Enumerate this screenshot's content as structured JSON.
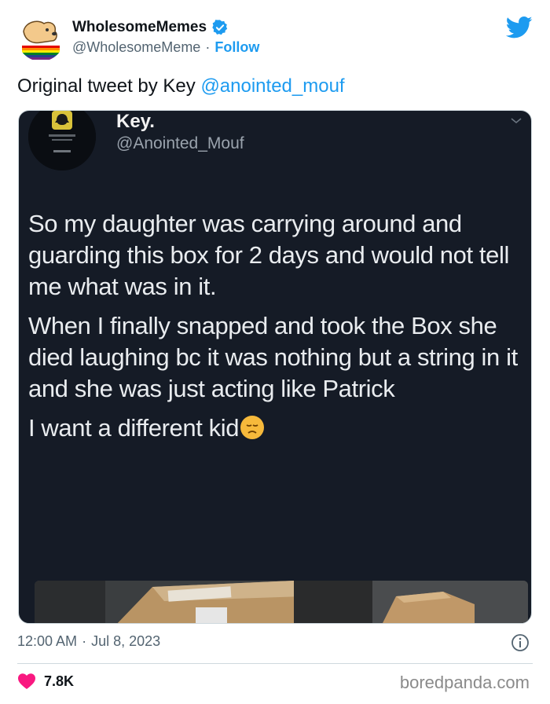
{
  "header": {
    "display_name": "WholesomeMemes",
    "handle": "@WholesomeMeme",
    "separator": "·",
    "follow_label": "Follow"
  },
  "tweet": {
    "text_prefix": "Original tweet by Key ",
    "mention": "@anointed_mouf"
  },
  "embedded": {
    "name": "Key.",
    "handle": "@Anointed_Mouf",
    "paragraphs": [
      "So my daughter was carrying around and guarding this box for 2 days and would not tell me what was in it.",
      "When I finally snapped and took the Box she died laughing bc it was nothing but a string in it and she was just acting like Patrick",
      "I want a different kid"
    ],
    "emoji": "disappointed-face"
  },
  "footer": {
    "time": "12:00 AM",
    "separator": "·",
    "date": "Jul 8, 2023",
    "like_count": "7.8K",
    "watermark": "boredpanda.com"
  },
  "colors": {
    "accent": "#1d9bf0",
    "heart": "#f91880",
    "media_bg": "#151b26"
  }
}
